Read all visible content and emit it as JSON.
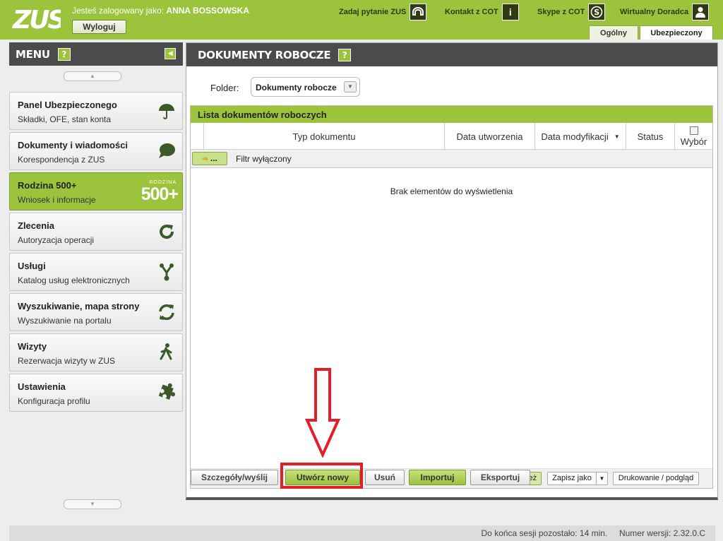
{
  "header": {
    "logo_text": "ZUS",
    "login_prefix": "Jesteś zalogowany jako:",
    "user_name": "ANNA BOSSOWSKA",
    "logout_label": "Wyloguj",
    "links": [
      {
        "label": "Zadaj pytanie ZUS",
        "icon": "chat-icon"
      },
      {
        "label": "Kontakt z COT",
        "icon": "info-icon"
      },
      {
        "label": "Skype z COT",
        "icon": "skype-icon"
      },
      {
        "label": "Wirtualny Doradca",
        "icon": "person-icon"
      }
    ],
    "tabs": [
      {
        "label": "Ogólny",
        "active": false
      },
      {
        "label": "Ubezpieczony",
        "active": true
      }
    ],
    "brand_color": "#9bc33c"
  },
  "sidebar": {
    "title": "MENU",
    "help_label": "?",
    "items": [
      {
        "title": "Panel Ubezpieczonego",
        "subtitle": "Składki, OFE, stan konta",
        "icon": "umbrella-icon",
        "active": false
      },
      {
        "title": "Dokumenty i wiadomości",
        "subtitle": "Korespondencja z ZUS",
        "icon": "speech-bubble-icon",
        "active": false
      },
      {
        "title": "Rodzina 500+",
        "subtitle": "Wniosek i informacje",
        "icon": "rodzina-500-logo",
        "active": true,
        "badge_big": "500+",
        "badge_small": "RODZINA"
      },
      {
        "title": "Zlecenia",
        "subtitle": "Autoryzacja operacji",
        "icon": "refresh-icon",
        "active": false
      },
      {
        "title": "Usługi",
        "subtitle": "Katalog usług elektronicznych",
        "icon": "network-icon",
        "active": false
      },
      {
        "title": "Wyszukiwanie, mapa strony",
        "subtitle": "Wyszukiwanie na portalu",
        "icon": "sync-icon",
        "active": false
      },
      {
        "title": "Wizyty",
        "subtitle": "Rezerwacja wizyty w ZUS",
        "icon": "walking-person-icon",
        "active": false
      },
      {
        "title": "Ustawienia",
        "subtitle": "Konfiguracja profilu",
        "icon": "puzzle-icon",
        "active": false
      }
    ]
  },
  "main": {
    "title": "DOKUMENTY ROBOCZE",
    "help_label": "?",
    "folder_label": "Folder:",
    "folder_value": "Dokumenty robocze",
    "list_title": "Lista dokumentów roboczych",
    "columns": [
      "Typ dokumentu",
      "Data utworzenia",
      "Data modyfikacji",
      "Status",
      "Wybór"
    ],
    "filter_button": "...",
    "filter_text": "Filtr wyłączony",
    "empty_message": "Brak elementów do wyświetlenia",
    "list_actions": [
      "Odśwież",
      "Zapisz jako",
      "Drukowanie / podgląd"
    ],
    "bottom_buttons": [
      {
        "label": "Szczegóły/wyślij",
        "green": false
      },
      {
        "label": "Utwórz nowy",
        "green": true
      },
      {
        "label": "Usuń",
        "green": false
      },
      {
        "label": "Importuj",
        "green": true
      },
      {
        "label": "Eksportuj",
        "green": false
      }
    ]
  },
  "annotation": {
    "highlight_color": "#e41e26"
  },
  "footer": {
    "session_text": "Do końca sesji pozostało: 14 min.",
    "version_text": "Numer wersji: 2.32.0.C"
  }
}
